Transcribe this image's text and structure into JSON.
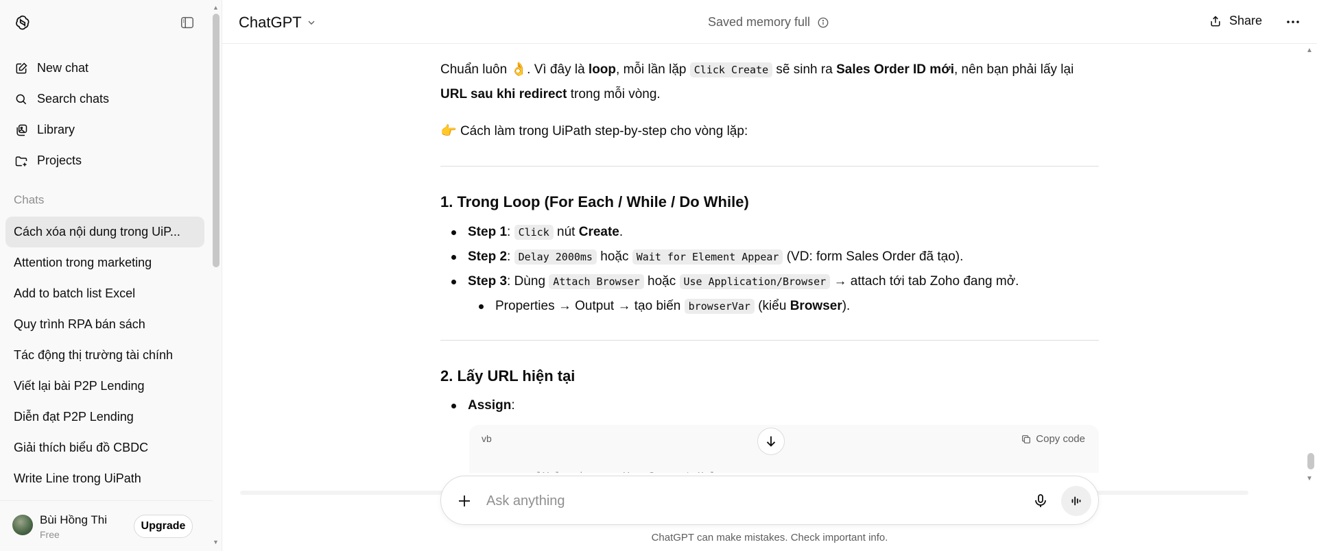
{
  "sidebar": {
    "nav": [
      {
        "label": "New chat",
        "icon": "new-chat-icon"
      },
      {
        "label": "Search chats",
        "icon": "search-icon"
      },
      {
        "label": "Library",
        "icon": "library-icon"
      },
      {
        "label": "Projects",
        "icon": "folder-icon"
      }
    ],
    "chats_label": "Chats",
    "chats": [
      "Cách xóa nội dung trong UiP...",
      "Attention trong marketing",
      "Add to batch list Excel",
      "Quy trình RPA bán sách",
      "Tác động thị trường tài chính",
      "Viết lại bài P2P Lending",
      "Diễn đạt P2P Lending",
      "Giải thích biểu đồ CBDC",
      "Write Line trong UiPath"
    ],
    "active_chat_index": 0,
    "user": {
      "name": "Bùi Hồng Thi",
      "plan": "Free",
      "upgrade_label": "Upgrade"
    }
  },
  "header": {
    "model": "ChatGPT",
    "memory_status": "Saved memory full",
    "share_label": "Share"
  },
  "message": {
    "p1": {
      "t1": "Chuẩn luôn ",
      "emoji1": "👌",
      "t2": ". Vì đây là ",
      "b1": "loop",
      "t3": ", mỗi lần lặp ",
      "c1": "Click Create",
      "t4": " sẽ sinh ra ",
      "b2": "Sales Order ID mới",
      "t5": ", nên bạn phải lấy lại ",
      "b3": "URL sau khi redirect",
      "t6": " trong mỗi vòng."
    },
    "p2": {
      "emoji": "👉",
      "text": " Cách làm trong UiPath step-by-step cho vòng lặp:"
    },
    "section1": {
      "heading": "1. Trong Loop (For Each / While / Do While)",
      "step1": {
        "label": "Step 1",
        "sep": ": ",
        "code": "Click",
        "text": " nút ",
        "bold": "Create",
        "end": "."
      },
      "step2": {
        "label": "Step 2",
        "sep": ": ",
        "code1": "Delay 2000ms",
        "text1": " hoặc ",
        "code2": "Wait for Element Appear",
        "text2": " (VD: form Sales Order đã tạo)."
      },
      "step3": {
        "label": "Step 3",
        "sep": ": Dùng ",
        "code1": "Attach Browser",
        "text1": " hoặc ",
        "code2": "Use Application/Browser",
        "text2": " → attach tới tab Zoho đang mở."
      },
      "sub": {
        "text1": "Properties → Output → tạo biến ",
        "code": "browserVar",
        "text2": " (kiểu ",
        "bold": "Browser",
        "end": ")."
      }
    },
    "section2": {
      "heading": "2. Lấy URL hiện tại",
      "item": {
        "bold": "Assign",
        "end": ":"
      },
      "code_lang": "vb",
      "copy_label": "Copy code",
      "code_partial": "urlVal = browserVar.Current.Url"
    }
  },
  "composer": {
    "placeholder": "Ask anything",
    "disclaimer": "ChatGPT can make mistakes. Check important info."
  }
}
